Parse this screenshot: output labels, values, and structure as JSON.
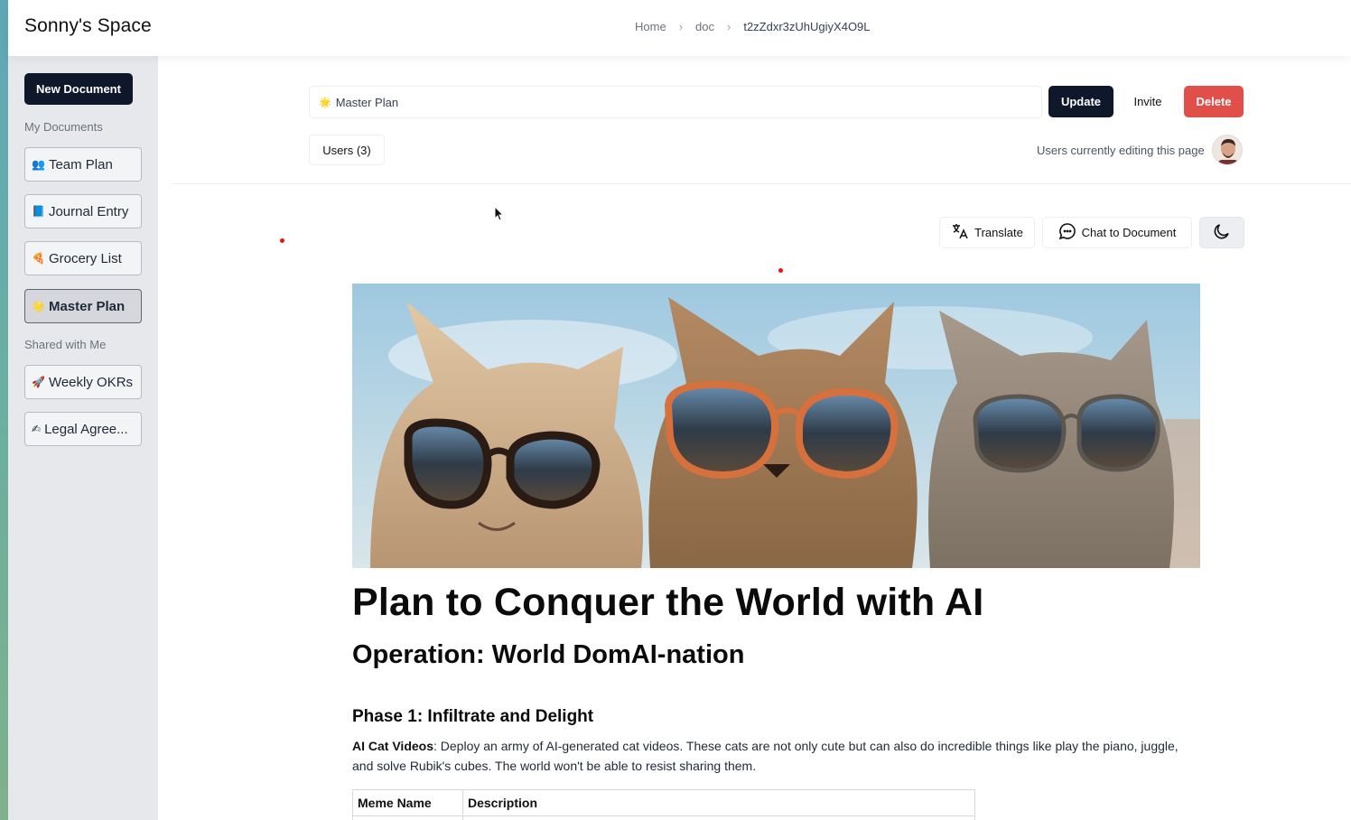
{
  "app": {
    "title": "Sonny's Space"
  },
  "breadcrumb": {
    "items": [
      "Home",
      "doc",
      "t2zZdxr3zUhUgiyX4O9L"
    ]
  },
  "sidebar": {
    "new_document_label": "New Document",
    "my_documents_label": "My Documents",
    "my_documents": [
      {
        "emoji": "👥",
        "label": "Team Plan",
        "active": false
      },
      {
        "emoji": "📘",
        "label": "Journal Entry",
        "active": false
      },
      {
        "emoji": "🍕",
        "label": "Grocery List",
        "active": false
      },
      {
        "emoji": "🌟",
        "label": "Master Plan",
        "active": true
      }
    ],
    "shared_label": "Shared with Me",
    "shared": [
      {
        "emoji": "🚀",
        "label": "Weekly OKRs"
      },
      {
        "emoji": "✍",
        "label": "Legal Agree..."
      }
    ]
  },
  "doc_header": {
    "title_emoji": "🌟",
    "title_value": "Master Plan",
    "update_label": "Update",
    "invite_label": "Invite",
    "delete_label": "Delete",
    "users_label": "Users (3)",
    "editing_label": "Users currently editing this page"
  },
  "toolbar": {
    "translate_label": "Translate",
    "chat_label": "Chat to Document",
    "dark_mode_icon": "moon-icon"
  },
  "document": {
    "h1": "Plan to Conquer the World with AI",
    "h2": "Operation: World DomAI-nation",
    "h3": "Phase 1: Infiltrate and Delight",
    "p1_bold": "AI Cat Videos",
    "p1_rest": ": Deploy an army of AI-generated cat videos. These cats are not only cute but can also do incredible things like play the piano, juggle, and solve Rubik's cubes. The world won't be able to resist sharing them.",
    "table_headers": [
      "Meme Name",
      "Description"
    ]
  },
  "colors": {
    "primary": "#0f172a",
    "danger": "#e04f4a",
    "sidebar_bg": "#e7e8ec"
  }
}
